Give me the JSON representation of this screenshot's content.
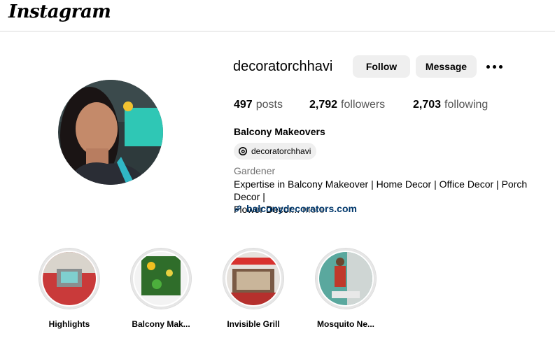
{
  "header": {
    "logo_text": "Instagram"
  },
  "profile": {
    "username": "decoratorchhavi",
    "follow_label": "Follow",
    "message_label": "Message",
    "stats": [
      {
        "value": "497",
        "label": "posts"
      },
      {
        "value": "2,792",
        "label": "followers"
      },
      {
        "value": "2,703",
        "label": "following"
      }
    ],
    "full_name": "Balcony Makeovers",
    "threads_handle": "decoratorchhavi",
    "category": "Gardener",
    "bio_line1": "Expertise in Balcony Makeover | Home Decor | Office Decor | Porch Decor |",
    "bio_line2": "Flower Decor...",
    "bio_more": "more",
    "link": "balconydecorators.com"
  },
  "highlights": [
    {
      "label": "Highlights"
    },
    {
      "label": "Balcony Mak..."
    },
    {
      "label": "Invisible Grill"
    },
    {
      "label": "Mosquito Ne..."
    }
  ],
  "colors": {
    "link": "#00376b",
    "button_bg": "#efefef",
    "muted_text": "#737373",
    "divider": "#dbdbdb"
  }
}
